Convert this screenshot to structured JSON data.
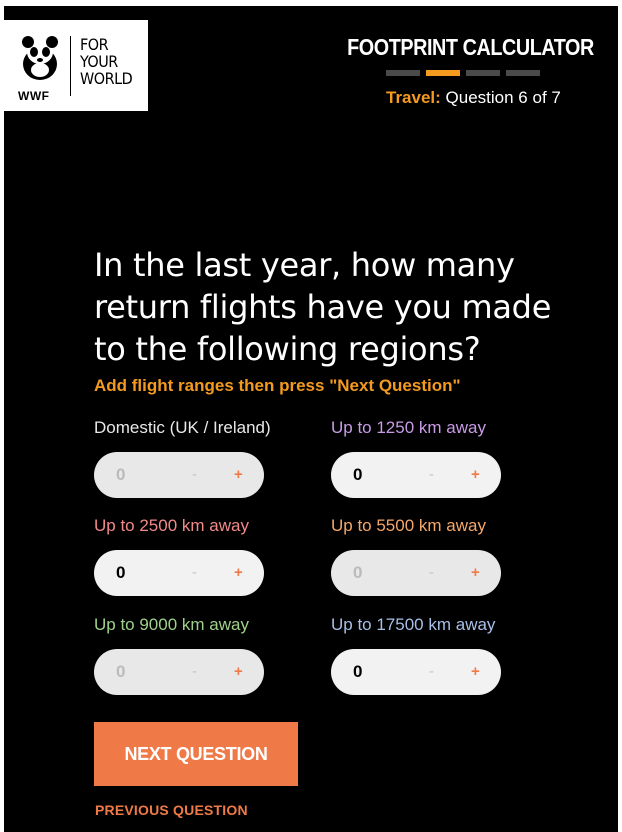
{
  "logo": {
    "brand": "WWF",
    "tagline": [
      "FOR",
      "YOUR",
      "WORLD"
    ]
  },
  "header": {
    "title": "FOOTPRINT CALCULATOR",
    "progress_segments": 4,
    "progress_active_index": 1,
    "category": "Travel:",
    "question_count": "Question 6 of 7"
  },
  "question": {
    "text": "In the last year, how many return flights have you made to the following regions?",
    "instruction": "Add flight ranges then press \"Next Question\""
  },
  "fields": [
    {
      "label": "Domestic (UK / Ireland)",
      "label_color": "#e8e8e8",
      "value": "0",
      "filled": false
    },
    {
      "label": "Up to 1250 km away",
      "label_color": "#c89be6",
      "value": "0",
      "filled": true
    },
    {
      "label": "Up to 2500 km away",
      "label_color": "#f28a8a",
      "value": "0",
      "filled": true
    },
    {
      "label": "Up to 5500 km away",
      "label_color": "#f5a76a",
      "value": "0",
      "filled": false
    },
    {
      "label": "Up to 9000 km away",
      "label_color": "#9fd18c",
      "value": "0",
      "filled": false
    },
    {
      "label": "Up to 17500 km away",
      "label_color": "#a9bfe8",
      "value": "0",
      "filled": true
    }
  ],
  "stepper": {
    "minus": "-",
    "plus": "+"
  },
  "buttons": {
    "next": "NEXT QUESTION",
    "previous": "PREVIOUS QUESTION"
  },
  "colors": {
    "accent_orange": "#f39a1f",
    "button_orange": "#f07a47",
    "background": "#000000"
  }
}
